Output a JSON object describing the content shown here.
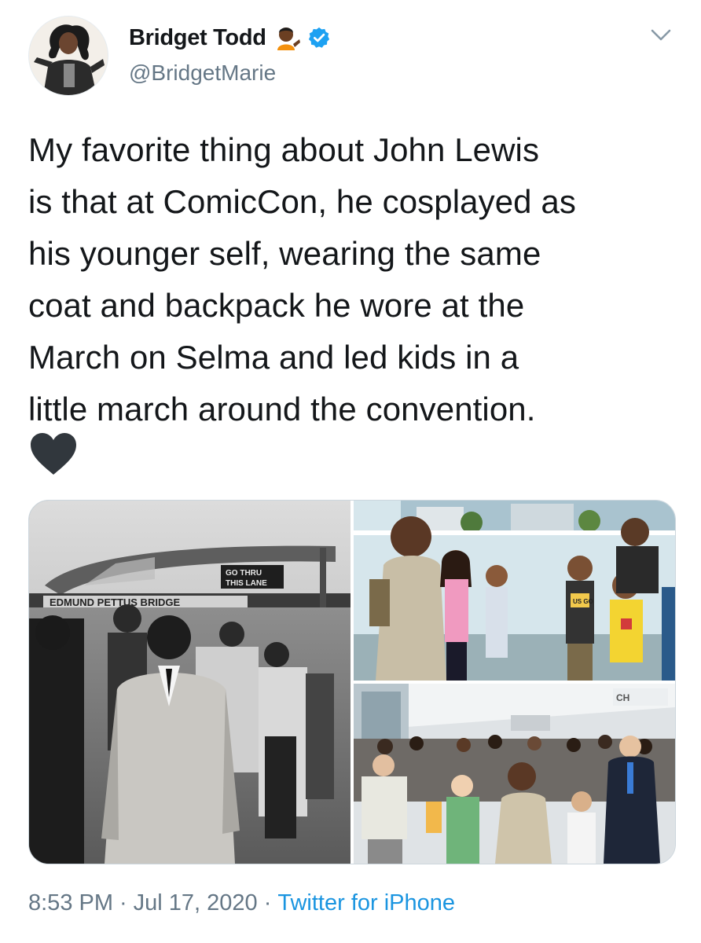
{
  "tweet": {
    "author": {
      "display_name": "Bridget Todd",
      "handle": "@BridgetMarie",
      "verified": true,
      "avatar_icon": "avatar-photo",
      "name_emoji_icon": "person-tipping-hand-emoji"
    },
    "text_lines": [
      "My favorite thing about John Lewis",
      "is that at ComicCon, he cosplayed as",
      "his younger self, wearing the same",
      "coat and backpack he wore at the",
      "March on Selma and led kids in a",
      "little march around the convention."
    ],
    "heart_icon": "black-heart-icon",
    "media": {
      "photo_left": {
        "bridge_sign": "EDMUND PETTUS BRIDGE",
        "lane_sign_line1": "GO THRU",
        "lane_sign_line2": "THIS LANE"
      },
      "photo_top_right": {
        "badge_text": "US GO"
      },
      "photo_bottom_right": {
        "wall_sign": "CH"
      }
    },
    "footer": {
      "time": "8:53 PM",
      "separator": "·",
      "date": "Jul 17, 2020",
      "source": "Twitter for iPhone"
    },
    "colors": {
      "text": "#14171a",
      "secondary": "#657786",
      "link": "#1b95e0",
      "verified": "#1da1f2"
    }
  }
}
